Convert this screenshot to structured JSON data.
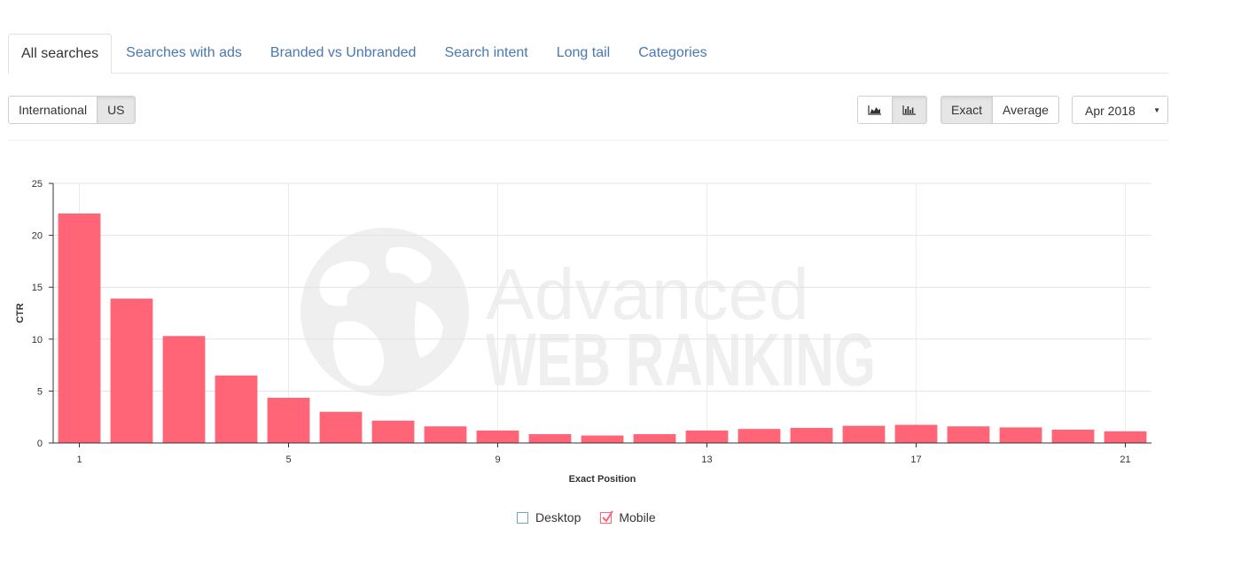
{
  "tabs": [
    {
      "label": "All searches",
      "active": true
    },
    {
      "label": "Searches with ads",
      "active": false
    },
    {
      "label": "Branded vs Unbranded",
      "active": false
    },
    {
      "label": "Search intent",
      "active": false
    },
    {
      "label": "Long tail",
      "active": false
    },
    {
      "label": "Categories",
      "active": false
    }
  ],
  "toolbar": {
    "region": {
      "international": "International",
      "us": "US",
      "selected": "US"
    },
    "chart_type": {
      "area_icon": "area-chart-icon",
      "bar_icon": "bar-chart-icon",
      "selected": "bar"
    },
    "mode": {
      "exact": "Exact",
      "average": "Average",
      "selected": "Exact"
    },
    "date": "Apr 2018"
  },
  "watermark": {
    "line1": "Advanced",
    "line2": "WEB RANKING",
    "icon": "globe-icon"
  },
  "legend": [
    {
      "label": "Desktop",
      "checked": false,
      "color": "#6aa3d8"
    },
    {
      "label": "Mobile",
      "checked": true,
      "color": "#ff6477"
    }
  ],
  "chart_data": {
    "type": "bar",
    "xlabel": "Exact Position",
    "ylabel": "CTR",
    "ylim": [
      0,
      25
    ],
    "yticks": [
      0,
      5,
      10,
      15,
      20,
      25
    ],
    "xtick_labels": [
      1,
      5,
      9,
      13,
      17,
      21
    ],
    "grid": true,
    "bar_color": "#ff6477",
    "series": [
      {
        "name": "Mobile",
        "x": [
          1,
          2,
          3,
          4,
          5,
          6,
          7,
          8,
          9,
          10,
          11,
          12,
          13,
          14,
          15,
          16,
          17,
          18,
          19,
          20,
          21
        ],
        "values": [
          22.1,
          13.9,
          10.3,
          6.5,
          4.35,
          3.0,
          2.15,
          1.6,
          1.2,
          0.85,
          0.72,
          0.85,
          1.2,
          1.35,
          1.45,
          1.65,
          1.75,
          1.6,
          1.5,
          1.28,
          1.12
        ]
      }
    ]
  }
}
